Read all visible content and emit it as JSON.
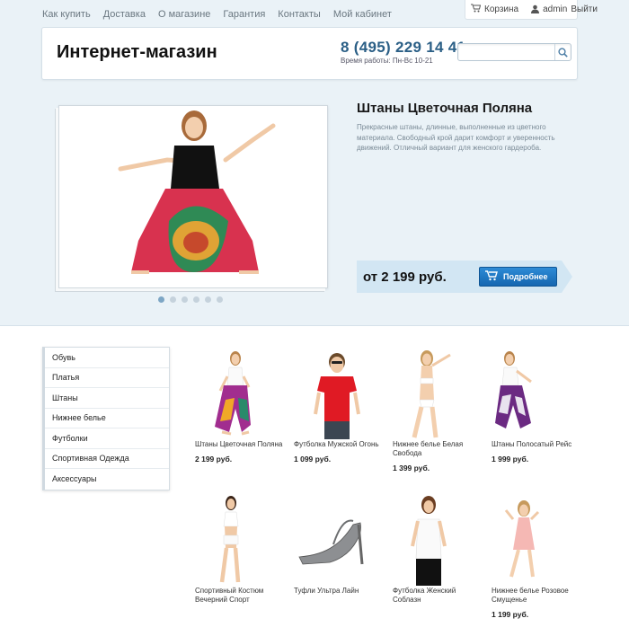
{
  "topnav": [
    {
      "label": "Как купить"
    },
    {
      "label": "Доставка"
    },
    {
      "label": "О магазине"
    },
    {
      "label": "Гарантия"
    },
    {
      "label": "Контакты"
    },
    {
      "label": "Мой кабинет"
    }
  ],
  "user_box": {
    "cart_label": "Корзина",
    "user_label": "admin",
    "logout_label": "Выйти"
  },
  "header": {
    "logo": "Интернет-магазин",
    "phone": "8 (495) 229 14 41",
    "hours": "Время работы: Пн-Вс 10-21",
    "search_placeholder": ""
  },
  "slider": {
    "title": "Штаны Цветочная Поляна",
    "description": "Прекрасные штаны, длинные, выполненные из цветного материала. Свободный крой дарит комфорт и уверенность движений. Отличный вариант для женского гардероба.",
    "price": "от 2 199 руб.",
    "button_label": "Подробнее",
    "dots": 6,
    "active_dot": 0
  },
  "categories": [
    {
      "label": "Обувь"
    },
    {
      "label": "Платья"
    },
    {
      "label": "Штаны"
    },
    {
      "label": "Нижнее белье"
    },
    {
      "label": "Футболки"
    },
    {
      "label": "Спортивная Одежда"
    },
    {
      "label": "Аксессуары"
    }
  ],
  "products": [
    {
      "name": "Штаны Цветочная Поляна",
      "price": "2 199 руб.",
      "image": "woman-harem-pants"
    },
    {
      "name": "Футболка Мужской Огонь",
      "price": "1 099 руб.",
      "image": "man-red-tshirt"
    },
    {
      "name": "Нижнее белье Белая Свобода",
      "price": "1 399 руб.",
      "image": "woman-white-lingerie"
    },
    {
      "name": "Штаны Полосатый Рейс",
      "price": "1 999 руб.",
      "image": "woman-purple-pants"
    },
    {
      "name": "Спортивный Костюм Вечерний Спорт",
      "price": "",
      "image": "woman-sport-suit"
    },
    {
      "name": "Туфли Ультра Лайн",
      "price": "",
      "image": "silver-heels"
    },
    {
      "name": "Футболка Женский Соблазн",
      "price": "",
      "image": "woman-white-tshirt"
    },
    {
      "name": "Нижнее белье Розовое Смущенье",
      "price": "1 199 руб.",
      "image": "woman-pink-slip"
    }
  ],
  "colors": {
    "accent": "#2b5f86",
    "button": "#1f78c4",
    "band": "#eaf2f7",
    "price_bar": "#d2e6f3"
  }
}
